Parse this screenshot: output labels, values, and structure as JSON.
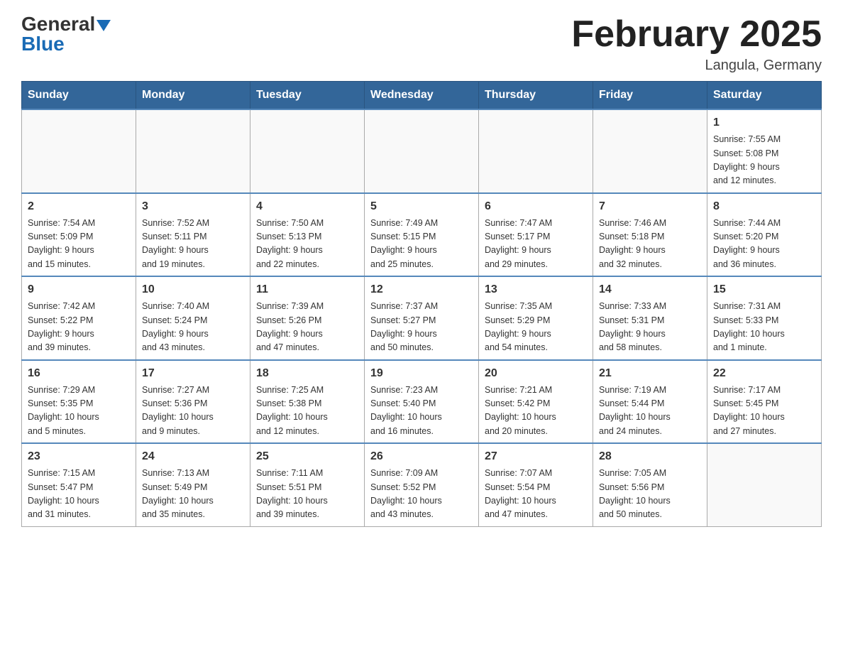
{
  "header": {
    "logo_general": "General",
    "logo_blue": "Blue",
    "month_title": "February 2025",
    "location": "Langula, Germany"
  },
  "days_of_week": [
    "Sunday",
    "Monday",
    "Tuesday",
    "Wednesday",
    "Thursday",
    "Friday",
    "Saturday"
  ],
  "weeks": [
    [
      {
        "day": "",
        "info": ""
      },
      {
        "day": "",
        "info": ""
      },
      {
        "day": "",
        "info": ""
      },
      {
        "day": "",
        "info": ""
      },
      {
        "day": "",
        "info": ""
      },
      {
        "day": "",
        "info": ""
      },
      {
        "day": "1",
        "info": "Sunrise: 7:55 AM\nSunset: 5:08 PM\nDaylight: 9 hours\nand 12 minutes."
      }
    ],
    [
      {
        "day": "2",
        "info": "Sunrise: 7:54 AM\nSunset: 5:09 PM\nDaylight: 9 hours\nand 15 minutes."
      },
      {
        "day": "3",
        "info": "Sunrise: 7:52 AM\nSunset: 5:11 PM\nDaylight: 9 hours\nand 19 minutes."
      },
      {
        "day": "4",
        "info": "Sunrise: 7:50 AM\nSunset: 5:13 PM\nDaylight: 9 hours\nand 22 minutes."
      },
      {
        "day": "5",
        "info": "Sunrise: 7:49 AM\nSunset: 5:15 PM\nDaylight: 9 hours\nand 25 minutes."
      },
      {
        "day": "6",
        "info": "Sunrise: 7:47 AM\nSunset: 5:17 PM\nDaylight: 9 hours\nand 29 minutes."
      },
      {
        "day": "7",
        "info": "Sunrise: 7:46 AM\nSunset: 5:18 PM\nDaylight: 9 hours\nand 32 minutes."
      },
      {
        "day": "8",
        "info": "Sunrise: 7:44 AM\nSunset: 5:20 PM\nDaylight: 9 hours\nand 36 minutes."
      }
    ],
    [
      {
        "day": "9",
        "info": "Sunrise: 7:42 AM\nSunset: 5:22 PM\nDaylight: 9 hours\nand 39 minutes."
      },
      {
        "day": "10",
        "info": "Sunrise: 7:40 AM\nSunset: 5:24 PM\nDaylight: 9 hours\nand 43 minutes."
      },
      {
        "day": "11",
        "info": "Sunrise: 7:39 AM\nSunset: 5:26 PM\nDaylight: 9 hours\nand 47 minutes."
      },
      {
        "day": "12",
        "info": "Sunrise: 7:37 AM\nSunset: 5:27 PM\nDaylight: 9 hours\nand 50 minutes."
      },
      {
        "day": "13",
        "info": "Sunrise: 7:35 AM\nSunset: 5:29 PM\nDaylight: 9 hours\nand 54 minutes."
      },
      {
        "day": "14",
        "info": "Sunrise: 7:33 AM\nSunset: 5:31 PM\nDaylight: 9 hours\nand 58 minutes."
      },
      {
        "day": "15",
        "info": "Sunrise: 7:31 AM\nSunset: 5:33 PM\nDaylight: 10 hours\nand 1 minute."
      }
    ],
    [
      {
        "day": "16",
        "info": "Sunrise: 7:29 AM\nSunset: 5:35 PM\nDaylight: 10 hours\nand 5 minutes."
      },
      {
        "day": "17",
        "info": "Sunrise: 7:27 AM\nSunset: 5:36 PM\nDaylight: 10 hours\nand 9 minutes."
      },
      {
        "day": "18",
        "info": "Sunrise: 7:25 AM\nSunset: 5:38 PM\nDaylight: 10 hours\nand 12 minutes."
      },
      {
        "day": "19",
        "info": "Sunrise: 7:23 AM\nSunset: 5:40 PM\nDaylight: 10 hours\nand 16 minutes."
      },
      {
        "day": "20",
        "info": "Sunrise: 7:21 AM\nSunset: 5:42 PM\nDaylight: 10 hours\nand 20 minutes."
      },
      {
        "day": "21",
        "info": "Sunrise: 7:19 AM\nSunset: 5:44 PM\nDaylight: 10 hours\nand 24 minutes."
      },
      {
        "day": "22",
        "info": "Sunrise: 7:17 AM\nSunset: 5:45 PM\nDaylight: 10 hours\nand 27 minutes."
      }
    ],
    [
      {
        "day": "23",
        "info": "Sunrise: 7:15 AM\nSunset: 5:47 PM\nDaylight: 10 hours\nand 31 minutes."
      },
      {
        "day": "24",
        "info": "Sunrise: 7:13 AM\nSunset: 5:49 PM\nDaylight: 10 hours\nand 35 minutes."
      },
      {
        "day": "25",
        "info": "Sunrise: 7:11 AM\nSunset: 5:51 PM\nDaylight: 10 hours\nand 39 minutes."
      },
      {
        "day": "26",
        "info": "Sunrise: 7:09 AM\nSunset: 5:52 PM\nDaylight: 10 hours\nand 43 minutes."
      },
      {
        "day": "27",
        "info": "Sunrise: 7:07 AM\nSunset: 5:54 PM\nDaylight: 10 hours\nand 47 minutes."
      },
      {
        "day": "28",
        "info": "Sunrise: 7:05 AM\nSunset: 5:56 PM\nDaylight: 10 hours\nand 50 minutes."
      },
      {
        "day": "",
        "info": ""
      }
    ]
  ]
}
